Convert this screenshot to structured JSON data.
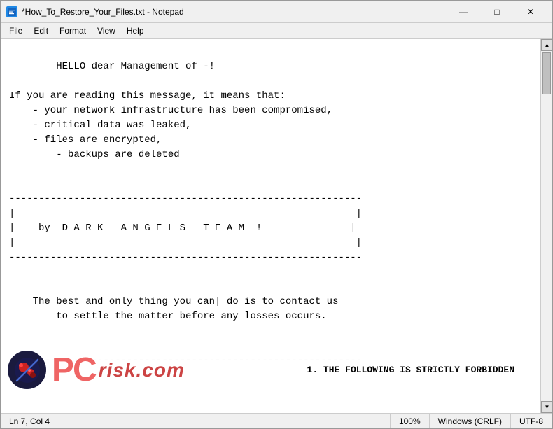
{
  "window": {
    "title": "*How_To_Restore_Your_Files.txt - Notepad",
    "icon_label": "N"
  },
  "title_controls": {
    "minimize": "—",
    "maximize": "□",
    "close": "✕"
  },
  "menu": {
    "items": [
      "File",
      "Edit",
      "Format",
      "View",
      "Help"
    ]
  },
  "content": {
    "text": "\n        HELLO dear Management of -!\n\nIf you are reading this message, it means that:\n    - your network infrastructure has been compromised,\n    - critical data was leaked,\n    - files are encrypted,\n        - backups are deleted\n\n\n------------------------------------------------------------\n|                                                          |\n|    by  D A R K   A N G E L S   T E A M  !               |\n|                                                          |\n------------------------------------------------------------\n\n\n    The best and only thing you can| do is to contact us\n        to settle the matter before any losses occurs.\n\n\n------------------------------------------------------------"
  },
  "watermark": {
    "logo_text_pc": "PC",
    "logo_text_risk": "risk",
    "logo_suffix": ".com",
    "right_text": "1. THE FOLLOWING IS STRICTLY FORBIDDEN"
  },
  "status_bar": {
    "position": "Ln 7, Col 4",
    "zoom": "100%",
    "line_ending": "Windows (CRLF)",
    "encoding": "UTF-8"
  }
}
